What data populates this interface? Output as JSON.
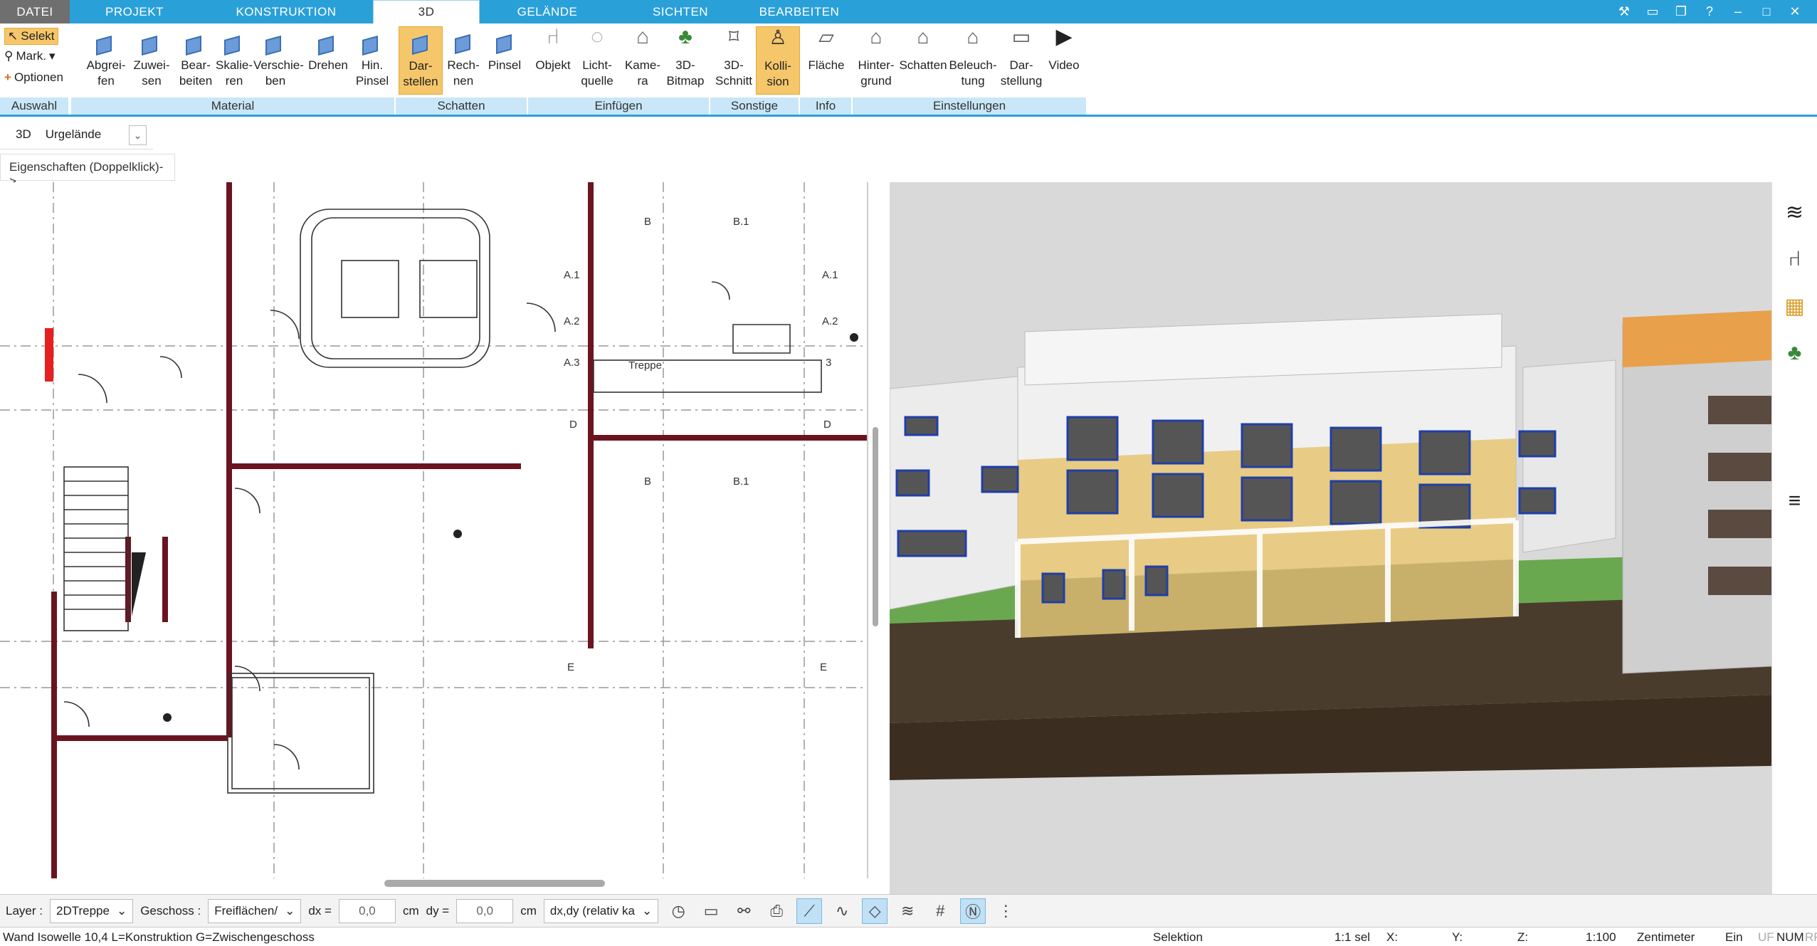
{
  "menu_tabs": [
    "DATEI",
    "PROJEKT",
    "KONSTRUKTION",
    "3D",
    "GELÄNDE",
    "SICHTEN",
    "BEARBEITEN"
  ],
  "active_tab": "3D",
  "window_controls": [
    "tools-icon",
    "window-icon",
    "restore-icon",
    "help-icon",
    "minimize-icon",
    "maximize-icon",
    "close-icon"
  ],
  "ribbon": {
    "auswahl": {
      "label": "Auswahl",
      "selekt": "Selekt",
      "mark": "Mark.",
      "optionen": "Optionen"
    },
    "material": {
      "label": "Material",
      "buttons": [
        "Abgrei-\nfen",
        "Zuwei-\nsen",
        "Bear-\nbeiten",
        "Skalie-\nren",
        "Verschie-\nben",
        "Drehen",
        "Hin.\nPinsel"
      ]
    },
    "schatten": {
      "label": "Schatten",
      "buttons": [
        "Dar-\nstellen",
        "Rech-\nnen",
        "Pinsel"
      ]
    },
    "einfuegen": {
      "label": "Einfügen",
      "buttons": [
        "Objekt",
        "Licht-\nquelle",
        "Kame-\nra",
        "3D-\nBitmap"
      ]
    },
    "sonstige": {
      "label": "Sonstige",
      "buttons": [
        "3D-\nSchnitt",
        "Kolli-\nsion"
      ]
    },
    "info": {
      "label": "Info",
      "buttons": [
        "Fläche"
      ]
    },
    "einstellungen": {
      "label": "Einstellungen",
      "buttons": [
        "Hinter-\ngrund",
        "Schatten",
        "Beleuch-\ntung",
        "Dar-\nstellung",
        "Video"
      ]
    }
  },
  "view_selector": {
    "mode": "3D",
    "value": "Urgelände"
  },
  "properties_label": "Eigenschaften (Doppelklick)->",
  "plan_labels": {
    "treppe": "Treppe",
    "a1": "A.1",
    "a2": "A.2",
    "a3": "A.3",
    "b": "B",
    "b1": "B.1",
    "d": "D",
    "e": "E",
    "c3": "3"
  },
  "layerbar": {
    "layer_label": "Layer :",
    "layer_value": "2DTreppe",
    "geschoss_label": "Geschoss :",
    "geschoss_value": "Freiflächen/",
    "dx_label": "dx =",
    "dx_value": "0,0",
    "dx_unit": "cm",
    "dy_label": "dy =",
    "dy_value": "0,0",
    "dy_unit": "cm",
    "mode_value": "dx,dy (relativ ka"
  },
  "status": {
    "left": "Wand Isowelle 10,4 L=Konstruktion G=Zwischengeschoss",
    "selektion": "Selektion",
    "sel": "1:1 sel",
    "x": "X:",
    "y": "Y:",
    "z": "Z:",
    "scale": "1:100",
    "unit": "Zentimeter",
    "ein": "Ein",
    "uf": "UF",
    "num": "NUM",
    "rf": "RF"
  }
}
